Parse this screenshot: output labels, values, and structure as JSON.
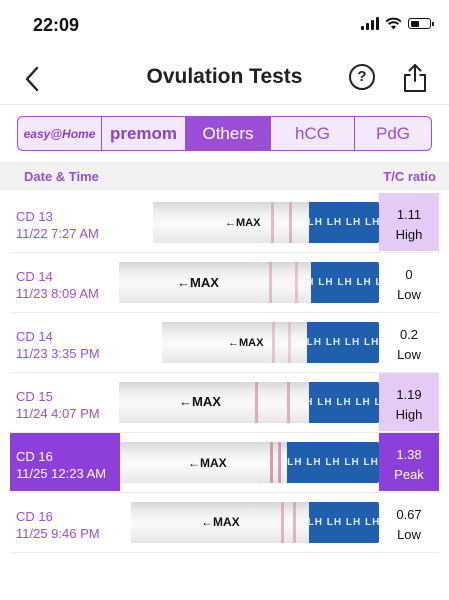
{
  "status_bar": {
    "time": "22:09"
  },
  "nav": {
    "title": "Ovulation Tests",
    "help_glyph": "?"
  },
  "brand_tabs": [
    {
      "label": "easy@Home",
      "selected": false
    },
    {
      "label": "premom",
      "selected": false
    },
    {
      "label": "Others",
      "selected": true
    },
    {
      "label": "hCG",
      "selected": false
    },
    {
      "label": "PdG",
      "selected": false
    }
  ],
  "table": {
    "col_date": "Date & Time",
    "col_ratio": "T/C ratio",
    "rows": [
      {
        "cd": "CD 13",
        "datetime": "11/22 7:27 AM",
        "ratio": "1.11",
        "level": "High",
        "max": "←MAX",
        "lh": "LH LH LH LH"
      },
      {
        "cd": "CD 14",
        "datetime": "11/23 8:09 AM",
        "ratio": "0",
        "level": "Low",
        "max": "←MAX",
        "lh": "LH LH LH LH LH"
      },
      {
        "cd": "CD 14",
        "datetime": "11/23 3:35 PM",
        "ratio": "0.2",
        "level": "Low",
        "max": "←MAX",
        "lh": "LH LH LH LH"
      },
      {
        "cd": "CD 15",
        "datetime": "11/24 4:07 PM",
        "ratio": "1.19",
        "level": "High",
        "max": "←MAX",
        "lh": "LH LH LH LH LH"
      },
      {
        "cd": "CD 16",
        "datetime": "11/25 12:23 AM",
        "ratio": "1.38",
        "level": "Peak",
        "max": "←MAX",
        "lh": "LH LH LH LH LH"
      },
      {
        "cd": "CD 16",
        "datetime": "11/25 9:46 PM",
        "ratio": "0.67",
        "level": "Low",
        "max": "←MAX",
        "lh": "LH LH LH LH"
      }
    ]
  },
  "colors": {
    "accent": "#9a4fd6",
    "peak": "#8d3fd9",
    "high": "#e4cbf5"
  }
}
